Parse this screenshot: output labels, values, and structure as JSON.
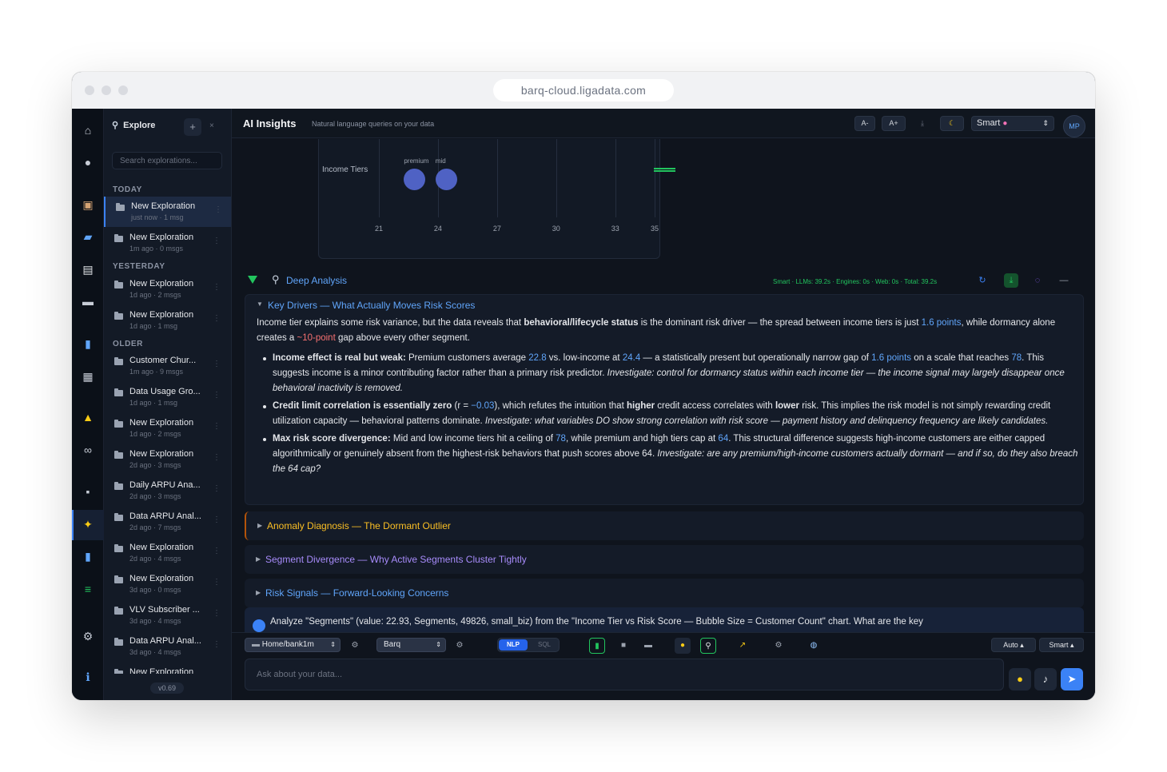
{
  "browser": {
    "url": "barq-cloud.ligadata.com"
  },
  "rail": {
    "icons": [
      "home-icon",
      "chat-icon",
      "box-icon",
      "folder-icon",
      "clipboard-icon",
      "card-icon",
      "bar-chart-icon",
      "inbox-icon",
      "bell-icon",
      "link-icon",
      "device-icon",
      "sparkles-icon",
      "analytics-icon",
      "books-icon",
      "gear-icon",
      "info-icon"
    ]
  },
  "sidebar": {
    "header": "Explore",
    "search_placeholder": "Search explorations...",
    "section_today": "TODAY",
    "section_yesterday": "YESTERDAY",
    "section_older": "OLDER",
    "items": [
      {
        "title": "New Exploration",
        "meta": "just now · 1 msg"
      },
      {
        "title": "New Exploration",
        "meta": "1m ago · 0 msgs"
      },
      {
        "title": "New Exploration",
        "meta": "1d ago · 2 msgs"
      },
      {
        "title": "New Exploration",
        "meta": "1d ago · 1 msg"
      },
      {
        "title": "Customer Chur...",
        "meta": "1m ago · 9 msgs"
      },
      {
        "title": "Data Usage Gro...",
        "meta": "1d ago · 1 msg"
      },
      {
        "title": "New Exploration",
        "meta": "1d ago · 2 msgs"
      },
      {
        "title": "New Exploration",
        "meta": "2d ago · 3 msgs"
      },
      {
        "title": "Daily ARPU Ana...",
        "meta": "2d ago · 3 msgs"
      },
      {
        "title": "Data ARPU Anal...",
        "meta": "2d ago · 7 msgs"
      },
      {
        "title": "New Exploration",
        "meta": "2d ago · 4 msgs"
      },
      {
        "title": "New Exploration",
        "meta": "3d ago · 0 msgs"
      },
      {
        "title": "VLV Subscriber ...",
        "meta": "3d ago · 4 msgs"
      },
      {
        "title": "Data ARPU Anal...",
        "meta": "3d ago · 4 msgs"
      },
      {
        "title": "New Exploration",
        "meta": ""
      }
    ],
    "version": "v0.69"
  },
  "topbar": {
    "title": "AI Insights",
    "subtitle": "Natural language queries on your data",
    "font_minus": "A-",
    "font_plus": "A+",
    "model": "Smart",
    "avatar": "MP"
  },
  "chart_data": {
    "type": "scatter",
    "ylabel": "Income Tiers",
    "x_ticks": [
      "21",
      "24",
      "27",
      "30",
      "33",
      "35"
    ],
    "points": [
      {
        "label": "premium",
        "x": 22.8
      },
      {
        "label": "mid",
        "x": 24.4
      }
    ]
  },
  "deep_analysis": {
    "title": "Deep Analysis",
    "stats": "Smart · LLMs: 39.2s · Engines: 0s · Web: 0s · Total: 39.2s",
    "key_drivers": {
      "title": "Key Drivers — What Actually Moves Risk Scores",
      "intro_1": "Income tier explains some risk variance, but the data reveals that ",
      "intro_bold": "behavioral/lifecycle status",
      "intro_2": " is the dominant risk driver — the spread between income tiers is just ",
      "intro_hl1": "1.6 points",
      "intro_3": ", while dormancy alone creates a ",
      "intro_hl2": "~10-point",
      "intro_4": " gap above every other segment.",
      "b1_bold": "Income effect is real but weak:",
      "b1_1": " Premium customers average ",
      "b1_v1": "22.8",
      "b1_2": " vs. low-income at ",
      "b1_v2": "24.4",
      "b1_3": " — a statistically present but operationally narrow gap of ",
      "b1_v3": "1.6 points",
      "b1_4": " on a scale that reaches ",
      "b1_v4": "78",
      "b1_5": ". This suggests income is a minor contributing factor rather than a primary risk predictor. ",
      "b1_it": "Investigate: control for dormancy status within each income tier — the income signal may largely disappear once behavioral inactivity is removed.",
      "b2_bold": "Credit limit correlation is essentially zero",
      "b2_1": " (r = ",
      "b2_v1": "−0.03",
      "b2_2": "), which refutes the intuition that ",
      "b2_b2": "higher",
      "b2_3": " credit access correlates with ",
      "b2_b3": "lower",
      "b2_4": " risk. This implies the risk model is not simply rewarding credit utilization capacity — behavioral patterns dominate. ",
      "b2_it": "Investigate: what variables DO show strong correlation with risk score — payment history and delinquency frequency are likely candidates.",
      "b3_bold": "Max risk score divergence:",
      "b3_1": " Mid and low income tiers hit a ceiling of ",
      "b3_v1": "78",
      "b3_2": ", while premium and high tiers cap at ",
      "b3_v2": "64",
      "b3_3": ". This structural difference suggests high-income customers are either capped algorithmically or genuinely absent from the highest-risk behaviors that push scores above 64. ",
      "b3_it": "Investigate: are any premium/high-income customers actually dormant — and if so, do they also breach the 64 cap?"
    },
    "anomaly": "Anomaly Diagnosis — The Dormant Outlier",
    "segment": "Segment Divergence — Why Active Segments Cluster Tightly",
    "risk": "Risk Signals — Forward-Looking Concerns",
    "query": "Analyze \"Segments\" (value: 22.93, Segments, 49826, small_biz) from the \"Income Tier vs Risk Score — Bubble Size = Customer Count\" chart. What are the key"
  },
  "toolbar": {
    "path": "Home/bank1m",
    "engine": "Barq",
    "nlp": "NLP",
    "sql": "SQL",
    "auto": "Auto ▴",
    "smart": "Smart ▴",
    "input_placeholder": "Ask about your data..."
  }
}
